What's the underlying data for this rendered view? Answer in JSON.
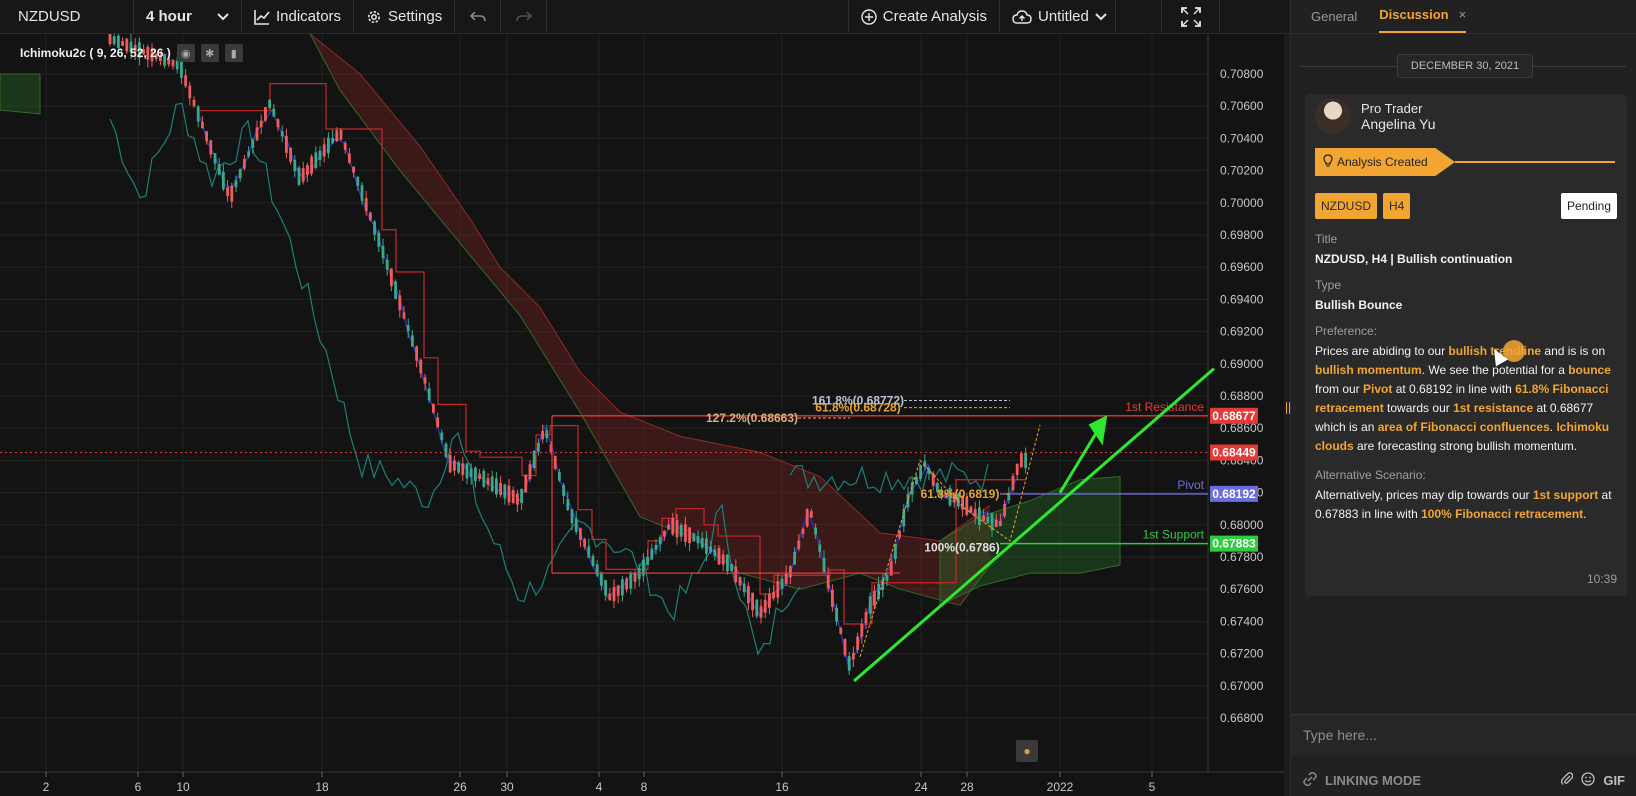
{
  "toolbar": {
    "symbol": "NZDUSD",
    "interval": "4 hour",
    "indicators_label": "Indicators",
    "settings_label": "Settings",
    "create_analysis_label": "Create Analysis",
    "layout_name": "Untitled"
  },
  "chart": {
    "indicator_legend": "Ichimoku2c ( 9, 26, 52, 26 )",
    "price_axis": [
      "0.70800",
      "0.70600",
      "0.70400",
      "0.70200",
      "0.70000",
      "0.69800",
      "0.69600",
      "0.69400",
      "0.69200",
      "0.69000",
      "0.68800",
      "0.68600",
      "0.68400",
      "0.68200",
      "0.68000",
      "0.67800",
      "0.67600",
      "0.67400",
      "0.67200",
      "0.67000",
      "0.66800"
    ],
    "time_axis": [
      "2",
      "6",
      "10",
      "18",
      "26",
      "30",
      "4",
      "8",
      "16",
      "24",
      "28",
      "2022",
      "5"
    ],
    "levels": {
      "resistance": {
        "label": "1st Resistance",
        "price": "0.68677",
        "color": "#e53935"
      },
      "pivot": {
        "label": "Pivot",
        "price": "0.68192",
        "color": "#6b6ee0"
      },
      "support": {
        "label": "1st Support",
        "price": "0.67883",
        "color": "#2ecc40"
      },
      "last_price": {
        "price": "0.68449",
        "color": "#e53935"
      }
    },
    "fib_labels": [
      "161.8%(0.68772)",
      "61.8%(0.68728)",
      "127.2%(0.68663)",
      "61.8%(0.6819)",
      "100%(0.6786)"
    ]
  },
  "panel": {
    "tabs": [
      {
        "label": "General"
      },
      {
        "label": "Discussion"
      }
    ],
    "close_glyph": "×",
    "date": "DECEMBER 30, 2021",
    "author_role": "Pro Trader",
    "author_name": "Angelina Yu",
    "created_label": "Analysis Created",
    "badges": [
      "NZDUSD",
      "H4"
    ],
    "status": "Pending",
    "title_label": "Title",
    "title_value": "NZDUSD, H4 | Bullish continuation",
    "type_label": "Type",
    "type_value": "Bullish Bounce",
    "preference_label": "Preference:",
    "alt_label": "Alternative Scenario:",
    "preference_parts": [
      "Prices are abiding to our ",
      "bullish trendline",
      " and is is on ",
      "bullish momentum",
      ". We see the potential for a ",
      "bounce",
      " from our ",
      "Pivot",
      " at 0.68192 in line with ",
      "61.8% Fibonacci retracement",
      " towards our ",
      "1st resistance",
      " at 0.68677 which is an ",
      "area of Fibonacci confluences",
      ". ",
      "Ichimoku clouds",
      " are forecasting strong bullish momentum."
    ],
    "alt_parts": [
      "Alternatively, prices may dip towards our ",
      "1st support",
      " at 0.67883 in line with ",
      "100% Fibonacci retracement",
      "."
    ],
    "time": "10:39",
    "input_placeholder": "Type here...",
    "linking_label": "LINKING MODE",
    "gif_label": "GIF"
  }
}
